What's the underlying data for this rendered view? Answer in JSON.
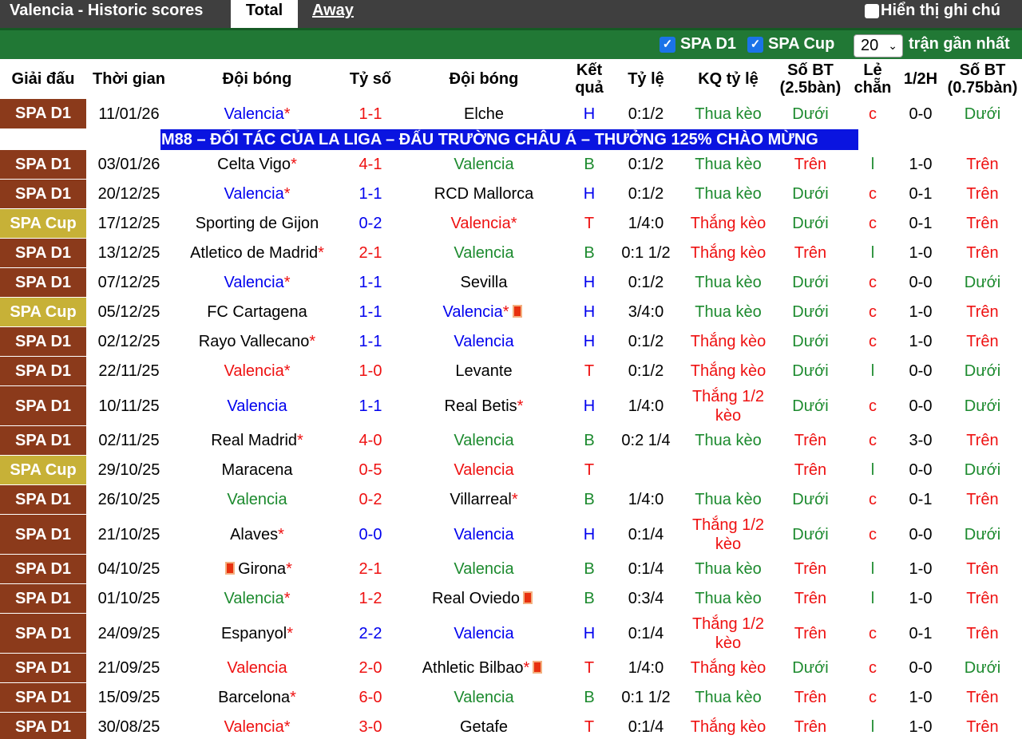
{
  "header": {
    "title": "Valencia - Historic scores",
    "tab_total": "Total",
    "tab_away": "Away",
    "show_notes": "Hiển thị ghi chú"
  },
  "filters": {
    "spa_d1": "SPA D1",
    "spa_cup": "SPA Cup",
    "count": "20",
    "recent_label": "trận gần nhất"
  },
  "columns": [
    "Giải đấu",
    "Thời gian",
    "Đội bóng",
    "Tỷ số",
    "Đội bóng",
    "Kết quả",
    "Tỷ lệ",
    "KQ tỷ lệ",
    "Số BT (2.5bàn)",
    "Lẻ chẵn",
    "1/2H",
    "Số BT (0.75bàn)"
  ],
  "ad": "M88 – ĐỐI TÁC CỦA LA LIGA – ĐẤU TRƯỜNG CHÂU Á – THƯỞNG 125% CHÀO MỪNG",
  "colors": {
    "league_d1": "#8b3a1b",
    "league_cup": "#c7b137",
    "header_green": "#217835",
    "ad_blue": "#0a14e0"
  },
  "matches": [
    {
      "league": "SPA D1",
      "date": "11/01/26",
      "home": "Valencia",
      "home_star": "*",
      "home_card": false,
      "home_color": "blue",
      "score": "1-1",
      "score_color": "red",
      "away": "Elche",
      "away_star": "",
      "away_card": false,
      "away_color": "black",
      "result": "H",
      "result_color": "blue",
      "odds": "0:1/2",
      "odds_result": "Thua kèo",
      "odds_result_color": "green",
      "ou": "Dưới",
      "ou_color": "green",
      "oe": "c",
      "oe_color": "red",
      "ht": "0-0",
      "ou2": "Dưới",
      "ou2_color": "green"
    },
    {
      "league": "SPA D1",
      "date": "03/01/26",
      "home": "Celta Vigo",
      "home_star": "*",
      "home_card": false,
      "home_color": "black",
      "score": "4-1",
      "score_color": "red",
      "away": "Valencia",
      "away_star": "",
      "away_card": false,
      "away_color": "green",
      "result": "B",
      "result_color": "green",
      "odds": "0:1/2",
      "odds_result": "Thua kèo",
      "odds_result_color": "green",
      "ou": "Trên",
      "ou_color": "red",
      "oe": "l",
      "oe_color": "green",
      "ht": "1-0",
      "ou2": "Trên",
      "ou2_color": "red"
    },
    {
      "league": "SPA D1",
      "date": "20/12/25",
      "home": "Valencia",
      "home_star": "*",
      "home_card": false,
      "home_color": "blue",
      "score": "1-1",
      "score_color": "blue",
      "away": "RCD Mallorca",
      "away_star": "",
      "away_card": false,
      "away_color": "black",
      "result": "H",
      "result_color": "blue",
      "odds": "0:1/2",
      "odds_result": "Thua kèo",
      "odds_result_color": "green",
      "ou": "Dưới",
      "ou_color": "green",
      "oe": "c",
      "oe_color": "red",
      "ht": "0-1",
      "ou2": "Trên",
      "ou2_color": "red"
    },
    {
      "league": "SPA Cup",
      "date": "17/12/25",
      "home": "Sporting de Gijon",
      "home_star": "",
      "home_card": false,
      "home_color": "black",
      "score": "0-2",
      "score_color": "blue",
      "away": "Valencia",
      "away_star": "*",
      "away_card": false,
      "away_color": "red",
      "result": "T",
      "result_color": "red",
      "odds": "1/4:0",
      "odds_result": "Thắng kèo",
      "odds_result_color": "red",
      "ou": "Dưới",
      "ou_color": "green",
      "oe": "c",
      "oe_color": "red",
      "ht": "0-1",
      "ou2": "Trên",
      "ou2_color": "red"
    },
    {
      "league": "SPA D1",
      "date": "13/12/25",
      "home": "Atletico de Madrid",
      "home_star": "*",
      "home_card": false,
      "home_color": "black",
      "score": "2-1",
      "score_color": "red",
      "away": "Valencia",
      "away_star": "",
      "away_card": false,
      "away_color": "green",
      "result": "B",
      "result_color": "green",
      "odds": "0:1 1/2",
      "odds_result": "Thắng kèo",
      "odds_result_color": "red",
      "ou": "Trên",
      "ou_color": "red",
      "oe": "l",
      "oe_color": "green",
      "ht": "1-0",
      "ou2": "Trên",
      "ou2_color": "red"
    },
    {
      "league": "SPA D1",
      "date": "07/12/25",
      "home": "Valencia",
      "home_star": "*",
      "home_card": false,
      "home_color": "blue",
      "score": "1-1",
      "score_color": "blue",
      "away": "Sevilla",
      "away_star": "",
      "away_card": false,
      "away_color": "black",
      "result": "H",
      "result_color": "blue",
      "odds": "0:1/2",
      "odds_result": "Thua kèo",
      "odds_result_color": "green",
      "ou": "Dưới",
      "ou_color": "green",
      "oe": "c",
      "oe_color": "red",
      "ht": "0-0",
      "ou2": "Dưới",
      "ou2_color": "green"
    },
    {
      "league": "SPA Cup",
      "date": "05/12/25",
      "home": "FC Cartagena",
      "home_star": "",
      "home_card": false,
      "home_color": "black",
      "score": "1-1",
      "score_color": "blue",
      "away": "Valencia",
      "away_star": "*",
      "away_card": true,
      "away_color": "blue",
      "result": "H",
      "result_color": "blue",
      "odds": "3/4:0",
      "odds_result": "Thua kèo",
      "odds_result_color": "green",
      "ou": "Dưới",
      "ou_color": "green",
      "oe": "c",
      "oe_color": "red",
      "ht": "1-0",
      "ou2": "Trên",
      "ou2_color": "red"
    },
    {
      "league": "SPA D1",
      "date": "02/12/25",
      "home": "Rayo Vallecano",
      "home_star": "*",
      "home_card": false,
      "home_color": "black",
      "score": "1-1",
      "score_color": "blue",
      "away": "Valencia",
      "away_star": "",
      "away_card": false,
      "away_color": "blue",
      "result": "H",
      "result_color": "blue",
      "odds": "0:1/2",
      "odds_result": "Thắng kèo",
      "odds_result_color": "red",
      "ou": "Dưới",
      "ou_color": "green",
      "oe": "c",
      "oe_color": "red",
      "ht": "1-0",
      "ou2": "Trên",
      "ou2_color": "red"
    },
    {
      "league": "SPA D1",
      "date": "22/11/25",
      "home": "Valencia",
      "home_star": "*",
      "home_card": false,
      "home_color": "red",
      "score": "1-0",
      "score_color": "red",
      "away": "Levante",
      "away_star": "",
      "away_card": false,
      "away_color": "black",
      "result": "T",
      "result_color": "red",
      "odds": "0:1/2",
      "odds_result": "Thắng kèo",
      "odds_result_color": "red",
      "ou": "Dưới",
      "ou_color": "green",
      "oe": "l",
      "oe_color": "green",
      "ht": "0-0",
      "ou2": "Dưới",
      "ou2_color": "green"
    },
    {
      "league": "SPA D1",
      "date": "10/11/25",
      "home": "Valencia",
      "home_star": "",
      "home_card": false,
      "home_color": "blue",
      "score": "1-1",
      "score_color": "blue",
      "away": "Real Betis",
      "away_star": "*",
      "away_card": false,
      "away_color": "black",
      "result": "H",
      "result_color": "blue",
      "odds": "1/4:0",
      "odds_result": "Thắng 1/2 kèo",
      "odds_result_color": "red",
      "ou": "Dưới",
      "ou_color": "green",
      "oe": "c",
      "oe_color": "red",
      "ht": "0-0",
      "ou2": "Dưới",
      "ou2_color": "green",
      "tall": true
    },
    {
      "league": "SPA D1",
      "date": "02/11/25",
      "home": "Real Madrid",
      "home_star": "*",
      "home_card": false,
      "home_color": "black",
      "score": "4-0",
      "score_color": "red",
      "away": "Valencia",
      "away_star": "",
      "away_card": false,
      "away_color": "green",
      "result": "B",
      "result_color": "green",
      "odds": "0:2 1/4",
      "odds_result": "Thua kèo",
      "odds_result_color": "green",
      "ou": "Trên",
      "ou_color": "red",
      "oe": "c",
      "oe_color": "red",
      "ht": "3-0",
      "ou2": "Trên",
      "ou2_color": "red"
    },
    {
      "league": "SPA Cup",
      "date": "29/10/25",
      "home": "Maracena",
      "home_star": "",
      "home_card": false,
      "home_color": "black",
      "score": "0-5",
      "score_color": "red",
      "away": "Valencia",
      "away_star": "",
      "away_card": false,
      "away_color": "red",
      "result": "T",
      "result_color": "red",
      "odds": "",
      "odds_result": "",
      "odds_result_color": "green",
      "ou": "Trên",
      "ou_color": "red",
      "oe": "l",
      "oe_color": "green",
      "ht": "0-0",
      "ou2": "Dưới",
      "ou2_color": "green"
    },
    {
      "league": "SPA D1",
      "date": "26/10/25",
      "home": "Valencia",
      "home_star": "",
      "home_card": false,
      "home_color": "green",
      "score": "0-2",
      "score_color": "red",
      "away": "Villarreal",
      "away_star": "*",
      "away_card": false,
      "away_color": "black",
      "result": "B",
      "result_color": "green",
      "odds": "1/4:0",
      "odds_result": "Thua kèo",
      "odds_result_color": "green",
      "ou": "Dưới",
      "ou_color": "green",
      "oe": "c",
      "oe_color": "red",
      "ht": "0-1",
      "ou2": "Trên",
      "ou2_color": "red"
    },
    {
      "league": "SPA D1",
      "date": "21/10/25",
      "home": "Alaves",
      "home_star": "*",
      "home_card": false,
      "home_color": "black",
      "score": "0-0",
      "score_color": "blue",
      "away": "Valencia",
      "away_star": "",
      "away_card": false,
      "away_color": "blue",
      "result": "H",
      "result_color": "blue",
      "odds": "0:1/4",
      "odds_result": "Thắng 1/2 kèo",
      "odds_result_color": "red",
      "ou": "Dưới",
      "ou_color": "green",
      "oe": "c",
      "oe_color": "red",
      "ht": "0-0",
      "ou2": "Dưới",
      "ou2_color": "green",
      "tall": true
    },
    {
      "league": "SPA D1",
      "date": "04/10/25",
      "home": "Girona",
      "home_star": "*",
      "home_card": true,
      "home_color": "black",
      "score": "2-1",
      "score_color": "red",
      "away": "Valencia",
      "away_star": "",
      "away_card": false,
      "away_color": "green",
      "result": "B",
      "result_color": "green",
      "odds": "0:1/4",
      "odds_result": "Thua kèo",
      "odds_result_color": "green",
      "ou": "Trên",
      "ou_color": "red",
      "oe": "l",
      "oe_color": "green",
      "ht": "1-0",
      "ou2": "Trên",
      "ou2_color": "red"
    },
    {
      "league": "SPA D1",
      "date": "01/10/25",
      "home": "Valencia",
      "home_star": "*",
      "home_card": false,
      "home_color": "green",
      "score": "1-2",
      "score_color": "red",
      "away": "Real Oviedo",
      "away_star": "",
      "away_card": true,
      "away_color": "black",
      "result": "B",
      "result_color": "green",
      "odds": "0:3/4",
      "odds_result": "Thua kèo",
      "odds_result_color": "green",
      "ou": "Trên",
      "ou_color": "red",
      "oe": "l",
      "oe_color": "green",
      "ht": "1-0",
      "ou2": "Trên",
      "ou2_color": "red"
    },
    {
      "league": "SPA D1",
      "date": "24/09/25",
      "home": "Espanyol",
      "home_star": "*",
      "home_card": false,
      "home_color": "black",
      "score": "2-2",
      "score_color": "blue",
      "away": "Valencia",
      "away_star": "",
      "away_card": false,
      "away_color": "blue",
      "result": "H",
      "result_color": "blue",
      "odds": "0:1/4",
      "odds_result": "Thắng 1/2 kèo",
      "odds_result_color": "red",
      "ou": "Trên",
      "ou_color": "red",
      "oe": "c",
      "oe_color": "red",
      "ht": "0-1",
      "ou2": "Trên",
      "ou2_color": "red",
      "tall": true
    },
    {
      "league": "SPA D1",
      "date": "21/09/25",
      "home": "Valencia",
      "home_star": "",
      "home_card": false,
      "home_color": "red",
      "score": "2-0",
      "score_color": "red",
      "away": "Athletic Bilbao",
      "away_star": "*",
      "away_card": true,
      "away_color": "black",
      "result": "T",
      "result_color": "red",
      "odds": "1/4:0",
      "odds_result": "Thắng kèo",
      "odds_result_color": "red",
      "ou": "Dưới",
      "ou_color": "green",
      "oe": "c",
      "oe_color": "red",
      "ht": "0-0",
      "ou2": "Dưới",
      "ou2_color": "green"
    },
    {
      "league": "SPA D1",
      "date": "15/09/25",
      "home": "Barcelona",
      "home_star": "*",
      "home_card": false,
      "home_color": "black",
      "score": "6-0",
      "score_color": "red",
      "away": "Valencia",
      "away_star": "",
      "away_card": false,
      "away_color": "green",
      "result": "B",
      "result_color": "green",
      "odds": "0:1 1/2",
      "odds_result": "Thua kèo",
      "odds_result_color": "green",
      "ou": "Trên",
      "ou_color": "red",
      "oe": "c",
      "oe_color": "red",
      "ht": "1-0",
      "ou2": "Trên",
      "ou2_color": "red"
    },
    {
      "league": "SPA D1",
      "date": "30/08/25",
      "home": "Valencia",
      "home_star": "*",
      "home_card": false,
      "home_color": "red",
      "score": "3-0",
      "score_color": "red",
      "away": "Getafe",
      "away_star": "",
      "away_card": false,
      "away_color": "black",
      "result": "T",
      "result_color": "red",
      "odds": "0:1/4",
      "odds_result": "Thắng kèo",
      "odds_result_color": "red",
      "ou": "Trên",
      "ou_color": "red",
      "oe": "l",
      "oe_color": "green",
      "ht": "1-0",
      "ou2": "Trên",
      "ou2_color": "red"
    }
  ]
}
